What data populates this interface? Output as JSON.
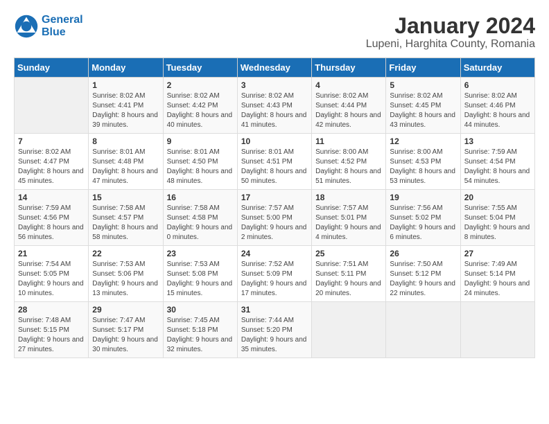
{
  "header": {
    "logo_line1": "General",
    "logo_line2": "Blue",
    "title": "January 2024",
    "subtitle": "Lupeni, Harghita County, Romania"
  },
  "calendar": {
    "days_of_week": [
      "Sunday",
      "Monday",
      "Tuesday",
      "Wednesday",
      "Thursday",
      "Friday",
      "Saturday"
    ],
    "weeks": [
      [
        {
          "day": "",
          "sunrise": "",
          "sunset": "",
          "daylight": ""
        },
        {
          "day": "1",
          "sunrise": "Sunrise: 8:02 AM",
          "sunset": "Sunset: 4:41 PM",
          "daylight": "Daylight: 8 hours and 39 minutes."
        },
        {
          "day": "2",
          "sunrise": "Sunrise: 8:02 AM",
          "sunset": "Sunset: 4:42 PM",
          "daylight": "Daylight: 8 hours and 40 minutes."
        },
        {
          "day": "3",
          "sunrise": "Sunrise: 8:02 AM",
          "sunset": "Sunset: 4:43 PM",
          "daylight": "Daylight: 8 hours and 41 minutes."
        },
        {
          "day": "4",
          "sunrise": "Sunrise: 8:02 AM",
          "sunset": "Sunset: 4:44 PM",
          "daylight": "Daylight: 8 hours and 42 minutes."
        },
        {
          "day": "5",
          "sunrise": "Sunrise: 8:02 AM",
          "sunset": "Sunset: 4:45 PM",
          "daylight": "Daylight: 8 hours and 43 minutes."
        },
        {
          "day": "6",
          "sunrise": "Sunrise: 8:02 AM",
          "sunset": "Sunset: 4:46 PM",
          "daylight": "Daylight: 8 hours and 44 minutes."
        }
      ],
      [
        {
          "day": "7",
          "sunrise": "Sunrise: 8:02 AM",
          "sunset": "Sunset: 4:47 PM",
          "daylight": "Daylight: 8 hours and 45 minutes."
        },
        {
          "day": "8",
          "sunrise": "Sunrise: 8:01 AM",
          "sunset": "Sunset: 4:48 PM",
          "daylight": "Daylight: 8 hours and 47 minutes."
        },
        {
          "day": "9",
          "sunrise": "Sunrise: 8:01 AM",
          "sunset": "Sunset: 4:50 PM",
          "daylight": "Daylight: 8 hours and 48 minutes."
        },
        {
          "day": "10",
          "sunrise": "Sunrise: 8:01 AM",
          "sunset": "Sunset: 4:51 PM",
          "daylight": "Daylight: 8 hours and 50 minutes."
        },
        {
          "day": "11",
          "sunrise": "Sunrise: 8:00 AM",
          "sunset": "Sunset: 4:52 PM",
          "daylight": "Daylight: 8 hours and 51 minutes."
        },
        {
          "day": "12",
          "sunrise": "Sunrise: 8:00 AM",
          "sunset": "Sunset: 4:53 PM",
          "daylight": "Daylight: 8 hours and 53 minutes."
        },
        {
          "day": "13",
          "sunrise": "Sunrise: 7:59 AM",
          "sunset": "Sunset: 4:54 PM",
          "daylight": "Daylight: 8 hours and 54 minutes."
        }
      ],
      [
        {
          "day": "14",
          "sunrise": "Sunrise: 7:59 AM",
          "sunset": "Sunset: 4:56 PM",
          "daylight": "Daylight: 8 hours and 56 minutes."
        },
        {
          "day": "15",
          "sunrise": "Sunrise: 7:58 AM",
          "sunset": "Sunset: 4:57 PM",
          "daylight": "Daylight: 8 hours and 58 minutes."
        },
        {
          "day": "16",
          "sunrise": "Sunrise: 7:58 AM",
          "sunset": "Sunset: 4:58 PM",
          "daylight": "Daylight: 9 hours and 0 minutes."
        },
        {
          "day": "17",
          "sunrise": "Sunrise: 7:57 AM",
          "sunset": "Sunset: 5:00 PM",
          "daylight": "Daylight: 9 hours and 2 minutes."
        },
        {
          "day": "18",
          "sunrise": "Sunrise: 7:57 AM",
          "sunset": "Sunset: 5:01 PM",
          "daylight": "Daylight: 9 hours and 4 minutes."
        },
        {
          "day": "19",
          "sunrise": "Sunrise: 7:56 AM",
          "sunset": "Sunset: 5:02 PM",
          "daylight": "Daylight: 9 hours and 6 minutes."
        },
        {
          "day": "20",
          "sunrise": "Sunrise: 7:55 AM",
          "sunset": "Sunset: 5:04 PM",
          "daylight": "Daylight: 9 hours and 8 minutes."
        }
      ],
      [
        {
          "day": "21",
          "sunrise": "Sunrise: 7:54 AM",
          "sunset": "Sunset: 5:05 PM",
          "daylight": "Daylight: 9 hours and 10 minutes."
        },
        {
          "day": "22",
          "sunrise": "Sunrise: 7:53 AM",
          "sunset": "Sunset: 5:06 PM",
          "daylight": "Daylight: 9 hours and 13 minutes."
        },
        {
          "day": "23",
          "sunrise": "Sunrise: 7:53 AM",
          "sunset": "Sunset: 5:08 PM",
          "daylight": "Daylight: 9 hours and 15 minutes."
        },
        {
          "day": "24",
          "sunrise": "Sunrise: 7:52 AM",
          "sunset": "Sunset: 5:09 PM",
          "daylight": "Daylight: 9 hours and 17 minutes."
        },
        {
          "day": "25",
          "sunrise": "Sunrise: 7:51 AM",
          "sunset": "Sunset: 5:11 PM",
          "daylight": "Daylight: 9 hours and 20 minutes."
        },
        {
          "day": "26",
          "sunrise": "Sunrise: 7:50 AM",
          "sunset": "Sunset: 5:12 PM",
          "daylight": "Daylight: 9 hours and 22 minutes."
        },
        {
          "day": "27",
          "sunrise": "Sunrise: 7:49 AM",
          "sunset": "Sunset: 5:14 PM",
          "daylight": "Daylight: 9 hours and 24 minutes."
        }
      ],
      [
        {
          "day": "28",
          "sunrise": "Sunrise: 7:48 AM",
          "sunset": "Sunset: 5:15 PM",
          "daylight": "Daylight: 9 hours and 27 minutes."
        },
        {
          "day": "29",
          "sunrise": "Sunrise: 7:47 AM",
          "sunset": "Sunset: 5:17 PM",
          "daylight": "Daylight: 9 hours and 30 minutes."
        },
        {
          "day": "30",
          "sunrise": "Sunrise: 7:45 AM",
          "sunset": "Sunset: 5:18 PM",
          "daylight": "Daylight: 9 hours and 32 minutes."
        },
        {
          "day": "31",
          "sunrise": "Sunrise: 7:44 AM",
          "sunset": "Sunset: 5:20 PM",
          "daylight": "Daylight: 9 hours and 35 minutes."
        },
        {
          "day": "",
          "sunrise": "",
          "sunset": "",
          "daylight": ""
        },
        {
          "day": "",
          "sunrise": "",
          "sunset": "",
          "daylight": ""
        },
        {
          "day": "",
          "sunrise": "",
          "sunset": "",
          "daylight": ""
        }
      ]
    ]
  }
}
